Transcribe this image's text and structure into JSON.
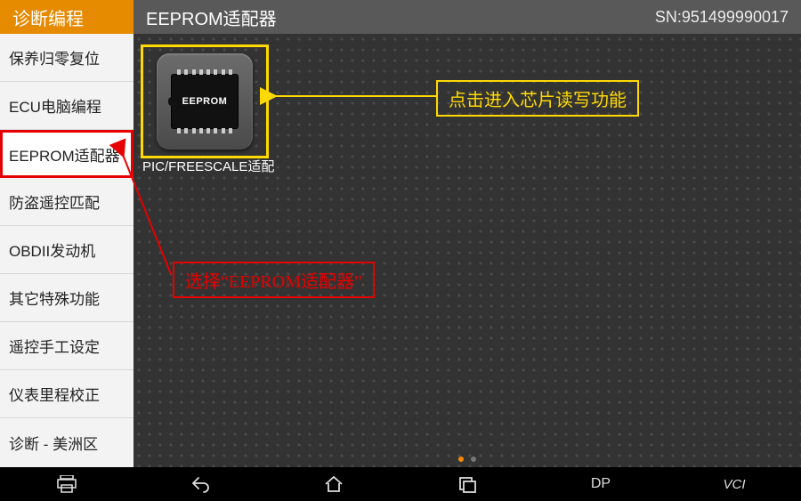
{
  "header": {
    "category": "诊断编程",
    "title": "EEPROM适配器",
    "sn_label": "SN:951499990017"
  },
  "sidebar": {
    "items": [
      {
        "label": "保养归零复位",
        "selected": false
      },
      {
        "label": "ECU电脑编程",
        "selected": false
      },
      {
        "label": "EEPROM适配器",
        "selected": true
      },
      {
        "label": "防盗遥控匹配",
        "selected": false
      },
      {
        "label": "OBDII发动机",
        "selected": false
      },
      {
        "label": "其它特殊功能",
        "selected": false
      },
      {
        "label": "遥控手工设定",
        "selected": false
      },
      {
        "label": "仪表里程校正",
        "selected": false
      },
      {
        "label": "诊断 - 美洲区",
        "selected": false
      }
    ]
  },
  "main": {
    "apps": [
      {
        "chip_text": "EEPROM",
        "caption": "PIC/FREESCALE适配"
      }
    ],
    "callouts": {
      "yellow": "点击进入芯片读写功能",
      "red": "选择“EEPROM适配器”"
    }
  },
  "navbar": {
    "dp_label": "DP",
    "vci_label": "VCI"
  }
}
